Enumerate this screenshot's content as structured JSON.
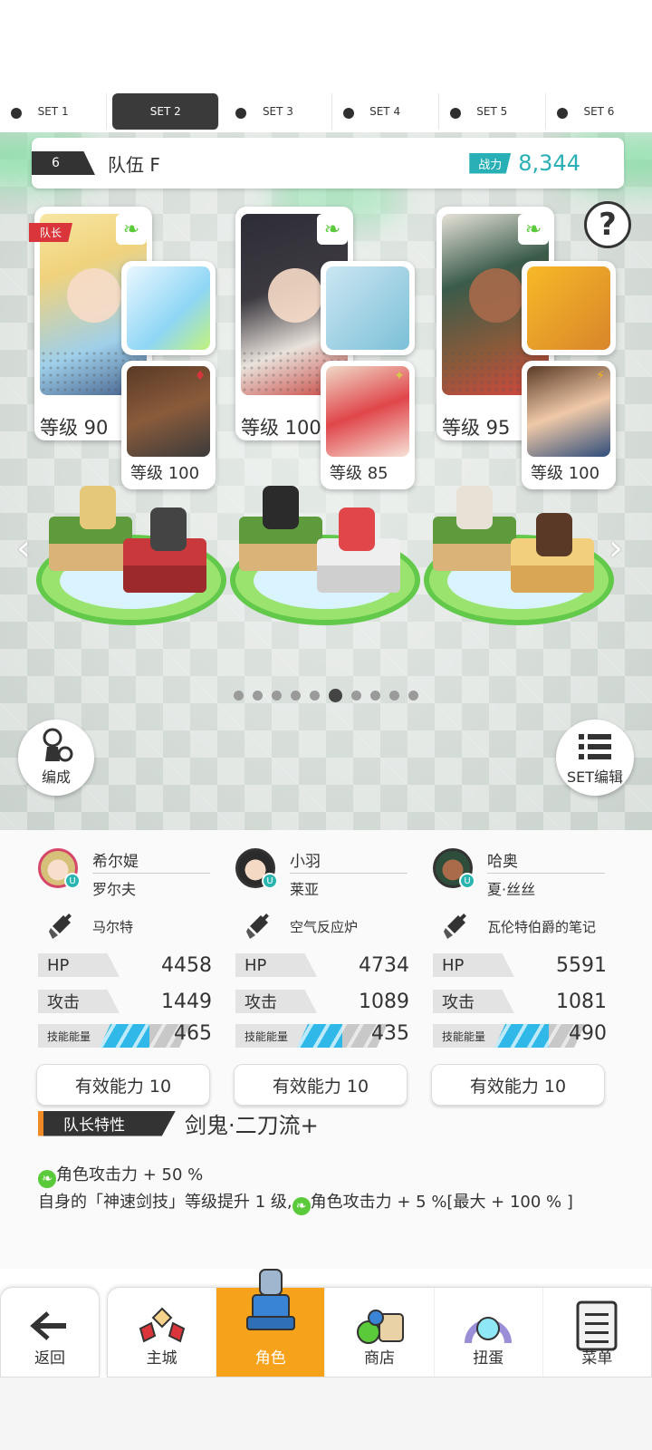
{
  "sets": [
    {
      "label": "SET 1",
      "active": false
    },
    {
      "label": "SET 2",
      "active": true
    },
    {
      "label": "SET 3",
      "active": false
    },
    {
      "label": "SET 4",
      "active": false
    },
    {
      "label": "SET 5",
      "active": false
    },
    {
      "label": "SET 6",
      "active": false
    }
  ],
  "team": {
    "number": "6",
    "name": "队伍 F",
    "power_label": "战力",
    "power_value": "8,344"
  },
  "help_icon": "?",
  "heroes": [
    {
      "level": "等级 90",
      "leader_label": "队长",
      "sub_level": "等级 100"
    },
    {
      "level": "等级 100",
      "sub_level": "等级 85"
    },
    {
      "level": "等级 95",
      "sub_level": "等级 100"
    }
  ],
  "pager": {
    "count": 10,
    "active_index": 5
  },
  "buttons": {
    "formation": "编成",
    "set_edit": "SET编辑"
  },
  "stats": [
    {
      "hero": "希尔媞",
      "support": "罗尔夫",
      "weapon": "马尔特",
      "hp_label": "HP",
      "hp": "4458",
      "atk_label": "攻击",
      "atk": "1449",
      "energy_label": "技能能量",
      "energy": "465",
      "energy_fill": 0.55,
      "ability": "有效能力 10"
    },
    {
      "hero": "小羽",
      "support": "莱亚",
      "weapon": "空气反应炉",
      "hp_label": "HP",
      "hp": "4734",
      "atk_label": "攻击",
      "atk": "1089",
      "energy_label": "技能能量",
      "energy": "435",
      "energy_fill": 0.5,
      "ability": "有效能力 10"
    },
    {
      "hero": "哈奥",
      "support": "夏·丝丝",
      "weapon": "瓦伦特伯爵的笔记",
      "hp_label": "HP",
      "hp": "5591",
      "atk_label": "攻击",
      "atk": "1081",
      "energy_label": "技能能量",
      "energy": "490",
      "energy_fill": 0.6,
      "ability": "有效能力 10"
    }
  ],
  "leader_trait": {
    "label": "队长特性",
    "name": "剑鬼·二刀流+",
    "line1": "角色攻击力 + 50 %",
    "line2a": "自身的「神速剑技」等级提升 1 级,",
    "line2b": "角色攻击力 + 5 %[最大 + 100 % ]"
  },
  "nav": {
    "back": "返回",
    "tabs": [
      {
        "label": "主城",
        "icon": "castle-icon",
        "active": false
      },
      {
        "label": "角色",
        "icon": "character-icon",
        "active": true
      },
      {
        "label": "商店",
        "icon": "shop-icon",
        "active": false
      },
      {
        "label": "扭蛋",
        "icon": "gacha-icon",
        "active": false
      },
      {
        "label": "菜单",
        "icon": "menu-icon",
        "active": false
      }
    ]
  },
  "colors": {
    "accent": "#29b0b6",
    "nav_active": "#f7a21b",
    "energy": "#2fb8e8",
    "leader": "#d9353b"
  }
}
